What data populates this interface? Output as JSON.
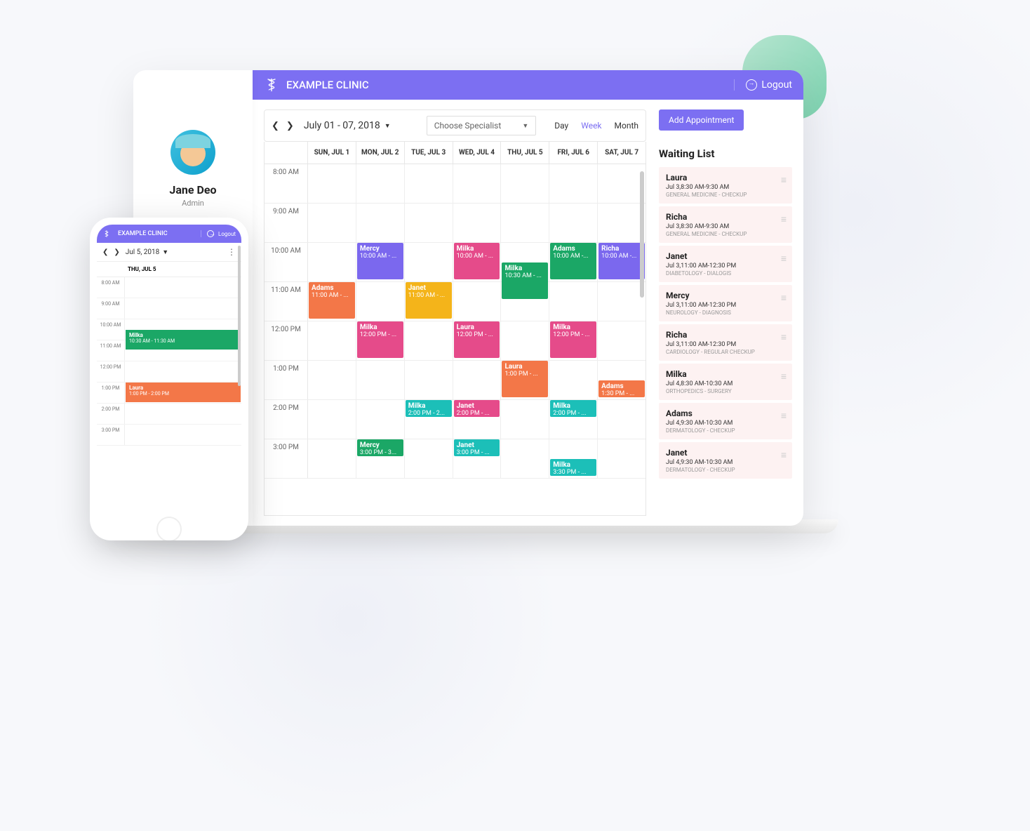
{
  "clinic_name": "EXAMPLE CLINIC",
  "logout_label": "Logout",
  "user": {
    "name": "Jane Deo",
    "role": "Admin"
  },
  "desktop": {
    "date_range": "July 01 - 07, 2018",
    "specialist_placeholder": "Choose Specialist",
    "views": {
      "day": "Day",
      "week": "Week",
      "month": "Month",
      "active": "Week"
    },
    "add_button": "Add Appointment",
    "day_headers": [
      "SUN, JUL 1",
      "MON, JUL 2",
      "TUE, JUL 3",
      "WED, JUL 4",
      "THU, JUL 5",
      "FRI, JUL 6",
      "SAT, JUL 7"
    ],
    "time_labels": [
      "8:00 AM",
      "9:00 AM",
      "10:00 AM",
      "11:00 AM",
      "12:00 PM",
      "1:00 PM",
      "2:00 PM",
      "3:00 PM"
    ],
    "events": [
      {
        "day": 1,
        "row": 2,
        "span": 1,
        "name": "Mercy",
        "time": "10:00 AM - ...",
        "color": "c-purple"
      },
      {
        "day": 3,
        "row": 2,
        "span": 1,
        "name": "Milka",
        "time": "10:00 AM - ...",
        "color": "c-pink"
      },
      {
        "day": 5,
        "row": 2,
        "span": 1,
        "name": "Adams",
        "time": "10:00 AM -...",
        "color": "c-green"
      },
      {
        "day": 6,
        "row": 2,
        "span": 1,
        "name": "Richa",
        "time": "10:00 AM -...",
        "color": "c-purple"
      },
      {
        "day": 4,
        "row": 2,
        "span": 1,
        "offset": 0.5,
        "name": "Milka",
        "time": "10:30 AM - ...",
        "color": "c-green"
      },
      {
        "day": 0,
        "row": 3,
        "span": 1,
        "name": "Adams",
        "time": "11:00 AM - ...",
        "color": "c-orange"
      },
      {
        "day": 2,
        "row": 3,
        "span": 1,
        "name": "Janet",
        "time": "11:00 AM - ...",
        "color": "c-yellow"
      },
      {
        "day": 1,
        "row": 4,
        "span": 1,
        "name": "Milka",
        "time": "12:00 PM - ...",
        "color": "c-pink"
      },
      {
        "day": 3,
        "row": 4,
        "span": 1,
        "name": "Laura",
        "time": "12:00 PM - ...",
        "color": "c-pink"
      },
      {
        "day": 5,
        "row": 4,
        "span": 1,
        "name": "Milka",
        "time": "12:00 PM - ...",
        "color": "c-pink"
      },
      {
        "day": 4,
        "row": 5,
        "span": 1,
        "name": "Laura",
        "time": "1:00 PM - ...",
        "color": "c-orange"
      },
      {
        "day": 6,
        "row": 5,
        "span": 0.5,
        "offset": 0.5,
        "name": "Adams",
        "time": "1:30 PM - ...",
        "color": "c-orange"
      },
      {
        "day": 2,
        "row": 6,
        "span": 0.5,
        "name": "Milka",
        "time": "2:00 PM - 2...",
        "color": "c-teal"
      },
      {
        "day": 3,
        "row": 6,
        "span": 0.5,
        "name": "Janet",
        "time": "2:00 PM - ...",
        "color": "c-pink"
      },
      {
        "day": 5,
        "row": 6,
        "span": 0.5,
        "name": "Milka",
        "time": "2:00 PM - ...",
        "color": "c-teal"
      },
      {
        "day": 1,
        "row": 7,
        "span": 0.5,
        "name": "Mercy",
        "time": "3:00 PM - 3...",
        "color": "c-green"
      },
      {
        "day": 3,
        "row": 7,
        "span": 0.5,
        "name": "Janet",
        "time": "3:00 PM - ...",
        "color": "c-teal"
      },
      {
        "day": 5,
        "row": 7,
        "span": 0.5,
        "offset": 0.5,
        "name": "Milka",
        "time": "3:30 PM - ...",
        "color": "c-teal"
      }
    ]
  },
  "waiting": {
    "title": "Waiting List",
    "items": [
      {
        "name": "Laura",
        "time": "Jul 3,8:30 AM-9:30 AM",
        "dept": "GENERAL MEDICINE - CHECKUP"
      },
      {
        "name": "Richa",
        "time": "Jul 3,8:30 AM-9:30 AM",
        "dept": "GENERAL MEDICINE - CHECKUP"
      },
      {
        "name": "Janet",
        "time": "Jul 3,11:00 AM-12:30 PM",
        "dept": "DIABETOLOGY - DIALOGIS"
      },
      {
        "name": "Mercy",
        "time": "Jul 3,11:00 AM-12:30 PM",
        "dept": "NEUROLOGY - DIAGNOSIS"
      },
      {
        "name": "Richa",
        "time": "Jul 3,11:00 AM-12:30 PM",
        "dept": "CARDIOLOGY - REGULAR CHECKUP"
      },
      {
        "name": "Milka",
        "time": "Jul 4,8:30 AM-10:30 AM",
        "dept": "ORTHOPEDICS - SURGERY"
      },
      {
        "name": "Adams",
        "time": "Jul 4,9:30 AM-10:30 AM",
        "dept": "DERMATOLOGY - CHECKUP"
      },
      {
        "name": "Janet",
        "time": "Jul 4,9:30 AM-10:30 AM",
        "dept": "DERMATOLOGY - CHECKUP"
      }
    ]
  },
  "phone": {
    "date": "Jul 5, 2018",
    "day_header": "THU, JUL 5",
    "time_labels": [
      "8:00 AM",
      "9:00 AM",
      "10:00 AM",
      "11:00 AM",
      "12:00 PM",
      "1:00 PM",
      "2:00 PM",
      "3:00 PM"
    ],
    "events": [
      {
        "row": 2,
        "offset": 0.5,
        "span": 1,
        "name": "Milka",
        "time": "10:30 AM - 11:30 AM",
        "color": "c-green"
      },
      {
        "row": 5,
        "span": 1,
        "name": "Laura",
        "time": "1:00 PM - 2:00 PM",
        "color": "c-orange"
      }
    ]
  }
}
